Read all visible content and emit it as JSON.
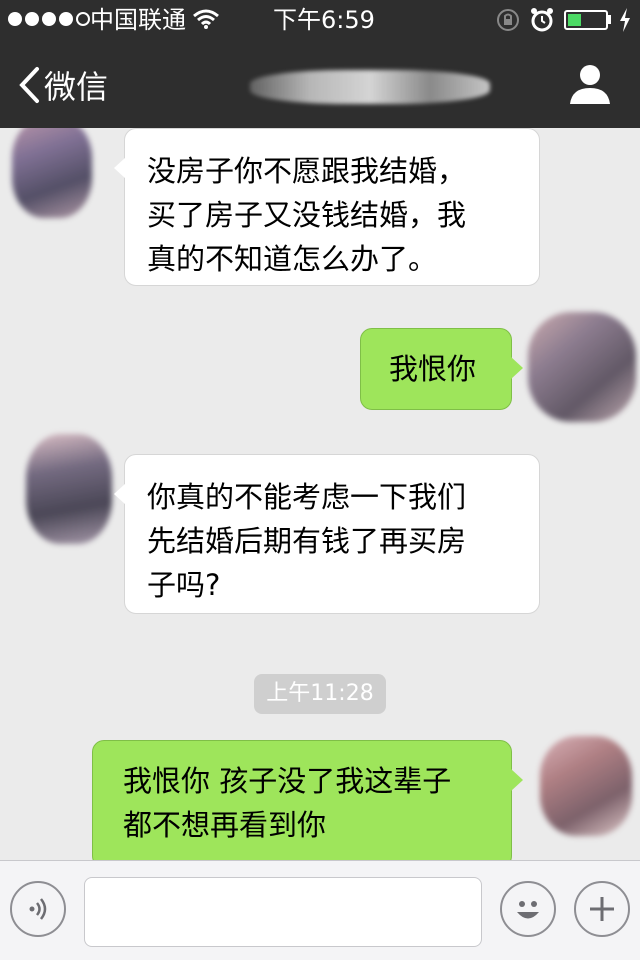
{
  "status": {
    "carrier": "中国联通",
    "time": "下午6:59",
    "battery_level": 0.35,
    "icons": [
      "signal-dots-icon",
      "wifi-icon",
      "rotation-lock-icon",
      "alarm-icon",
      "battery-icon",
      "charging-icon"
    ]
  },
  "nav": {
    "back_label": "微信",
    "icons": [
      "chevron-left-icon",
      "profile-icon"
    ]
  },
  "messages": [
    {
      "direction": "incoming",
      "text": "没房子你不愿跟我结婚，\n买了房子又没钱结婚，我\n真的不知道怎么办了。"
    },
    {
      "direction": "outgoing",
      "text": "我恨你"
    },
    {
      "direction": "incoming",
      "text": "你真的不能考虑一下我们\n先结婚后期有钱了再买房\n子吗?"
    },
    {
      "direction": "outgoing",
      "text": "我恨你 孩子没了我这辈子\n都不想再看到你"
    }
  ],
  "timestamp": "上午11:28",
  "input": {
    "value": "",
    "icons": [
      "voice-icon",
      "emoji-icon",
      "plus-icon"
    ]
  },
  "colors": {
    "bar": "#2e2e2e",
    "background": "#ebebeb",
    "outgoing_bubble": "#9ee55b",
    "incoming_bubble": "#ffffff",
    "battery_fill": "#4cd964"
  }
}
